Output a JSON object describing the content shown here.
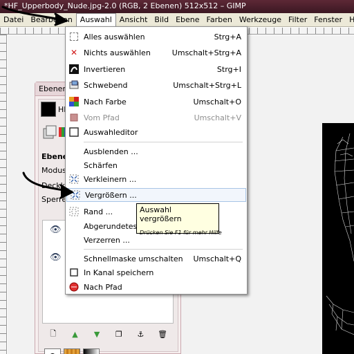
{
  "window": {
    "title": "*HF_Upperbody_Nude.jpg-2.0 (RGB, 2 Ebenen) 512x512 – GIMP"
  },
  "menubar": {
    "items": [
      "Datei",
      "Bearbeiten",
      "Auswahl",
      "Ansicht",
      "Bild",
      "Ebene",
      "Farben",
      "Werkzeuge",
      "Filter",
      "Fenster",
      "Hilfe"
    ],
    "active": "Auswahl"
  },
  "dock": {
    "title": "Ebenen,",
    "image_label": "HF_",
    "tab_label": "Ebenen",
    "mode_label": "Modus:",
    "opacity_label": "Deckk",
    "lock_label": "Sperre:"
  },
  "menu": {
    "items": [
      {
        "label": "Alles auswählen",
        "shortcut": "Strg+A",
        "icon": "select-all-icon"
      },
      {
        "label": "Nichts auswählen",
        "shortcut": "Umschalt+Strg+A",
        "icon": "select-none-icon"
      },
      {
        "label": "Invertieren",
        "shortcut": "Strg+I",
        "icon": "invert-selection-icon"
      },
      {
        "label": "Schwebend",
        "shortcut": "Umschalt+Strg+L",
        "icon": "float-icon"
      },
      {
        "label": "Nach Farbe",
        "shortcut": "Umschalt+O",
        "icon": "by-color-icon"
      },
      {
        "label": "Vom Pfad",
        "shortcut": "Umschalt+V",
        "icon": "from-path-icon",
        "disabled": true
      },
      {
        "label": "Auswahleditor",
        "shortcut": "",
        "icon": "selection-editor-icon"
      },
      {
        "label": "Ausblenden ...",
        "shortcut": "",
        "icon": ""
      },
      {
        "label": "Schärfen",
        "shortcut": "",
        "icon": ""
      },
      {
        "label": "Verkleinern ...",
        "shortcut": "",
        "icon": "shrink-icon"
      },
      {
        "label": "Vergrößern ...",
        "shortcut": "",
        "icon": "grow-icon",
        "highlighted": true
      },
      {
        "label": "Rand ...",
        "shortcut": "",
        "icon": "border-icon"
      },
      {
        "label": "Abgerundetes Re",
        "shortcut": "",
        "icon": ""
      },
      {
        "label": "Verzerren ...",
        "shortcut": "",
        "icon": ""
      },
      {
        "label": "Schnellmaske umschalten",
        "shortcut": "Umschalt+Q",
        "icon": ""
      },
      {
        "label": "In Kanal speichern",
        "shortcut": "",
        "icon": "save-to-channel-icon"
      },
      {
        "label": "Nach Pfad",
        "shortcut": "",
        "icon": "to-path-icon"
      }
    ]
  },
  "tooltip": {
    "title": "Auswahl vergrößern",
    "hint": "Drücken Sie F1 für mehr Hilfe"
  },
  "colors": {
    "titlebar": "#4a1f2b",
    "menu_highlight_border": "#a7c4e5",
    "tooltip_bg": "#ffffe1"
  }
}
